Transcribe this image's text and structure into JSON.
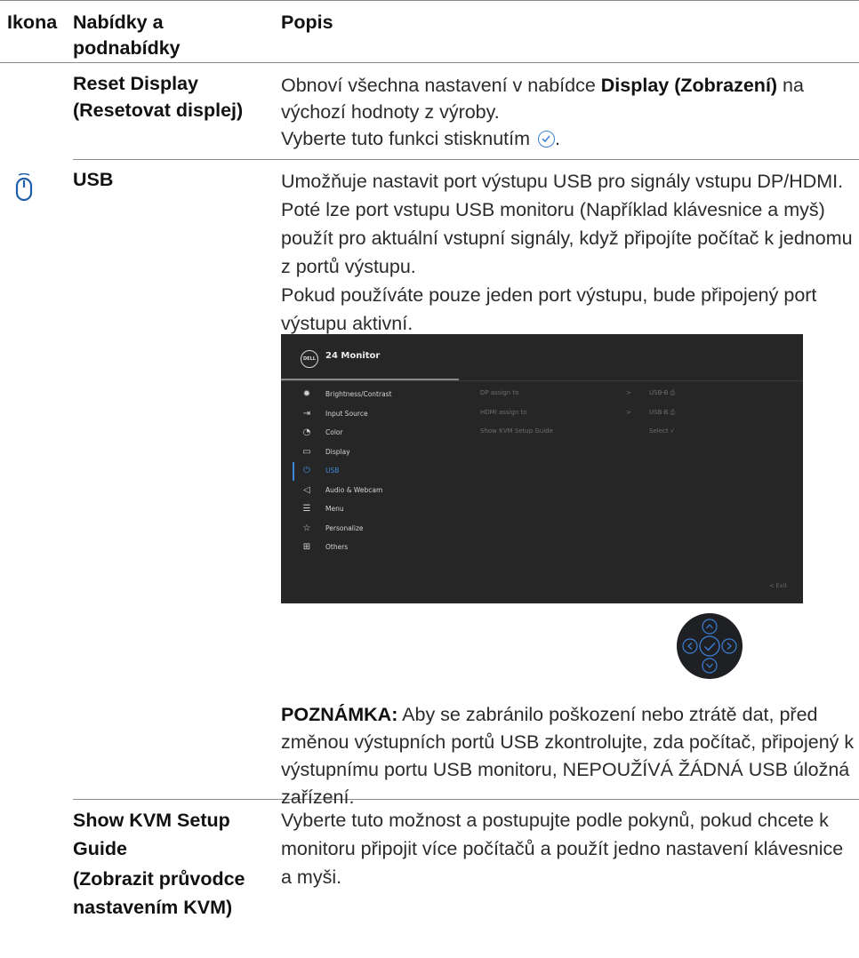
{
  "header": {
    "icon": "Ikona",
    "menus": "Nabídky a podnabídky",
    "description": "Popis"
  },
  "rows": {
    "reset_display": {
      "name": "Reset Display (Resetovat displej)",
      "desc_part1": "Obnoví všechna nastavení v nabídce ",
      "desc_bold": "Display (Zobrazení)",
      "desc_part2": " na výchozí hodnoty z výroby.",
      "desc_line2": "Vyberte tuto funkci stisknutím",
      "desc_line2_end": ".",
      "check_icon": "check-circle-icon"
    },
    "usb": {
      "icon": "usb-mouse-icon",
      "name": "USB",
      "desc_p1": "Umožňuje nastavit port výstupu USB pro signály vstupu DP/HDMI. Poté lze port vstupu USB monitoru (Například klávesnice a myš) použít pro aktuální vstupní signály, když připojíte počítač k jednomu z portů výstupu.",
      "desc_p2": "Pokud používáte pouze jeden port výstupu, bude připojený port výstupu aktivní.",
      "note_label": "POZNÁMKA:",
      "note_text": " Aby se zabránilo poškození nebo ztrátě dat, před změnou výstupních portů USB zkontrolujte, zda počítač, připojený k výstupnímu portu USB monitoru, NEPOUŽÍVÁ ŽÁDNÁ USB úložná zařízení."
    },
    "kvm": {
      "name1": "Show KVM Setup Guide",
      "name2": "(Zobrazit průvodce nastavením KVM)",
      "desc": "Vyberte tuto možnost a postupujte podle pokynů, pokud chcete k monitoru připojit více počítačů a použít jedno nastavení klávesnice a myši."
    }
  },
  "osd": {
    "logo": "DELL",
    "title": "24 Monitor",
    "menu": [
      {
        "label": "Brightness/Contrast",
        "icon": "sun-icon",
        "glyph": "✹"
      },
      {
        "label": "Input Source",
        "icon": "input-icon",
        "glyph": "⇥"
      },
      {
        "label": "Color",
        "icon": "palette-icon",
        "glyph": "◔"
      },
      {
        "label": "Display",
        "icon": "monitor-icon",
        "glyph": "▭"
      },
      {
        "label": "USB",
        "icon": "usb-mouse-icon",
        "glyph": "⏻"
      },
      {
        "label": "Audio & Webcam",
        "icon": "speaker-icon",
        "glyph": "◁"
      },
      {
        "label": "Menu",
        "icon": "menu-icon",
        "glyph": "☰"
      },
      {
        "label": "Personalize",
        "icon": "star-icon",
        "glyph": "☆"
      },
      {
        "label": "Others",
        "icon": "others-icon",
        "glyph": "⊞"
      }
    ],
    "active_index": 4,
    "options": [
      {
        "label": "DP assign to",
        "arrow": ">",
        "value": "USB-B ⎙"
      },
      {
        "label": "HDMI assign to",
        "arrow": ">",
        "value": "USB-B ⎙"
      },
      {
        "label": "Show KVM Setup Guide",
        "arrow": "",
        "value": "Select √"
      }
    ],
    "exit": "<  Exit"
  },
  "joystick": {
    "icon": "joystick-icon",
    "accent": "#3a7fd5"
  }
}
